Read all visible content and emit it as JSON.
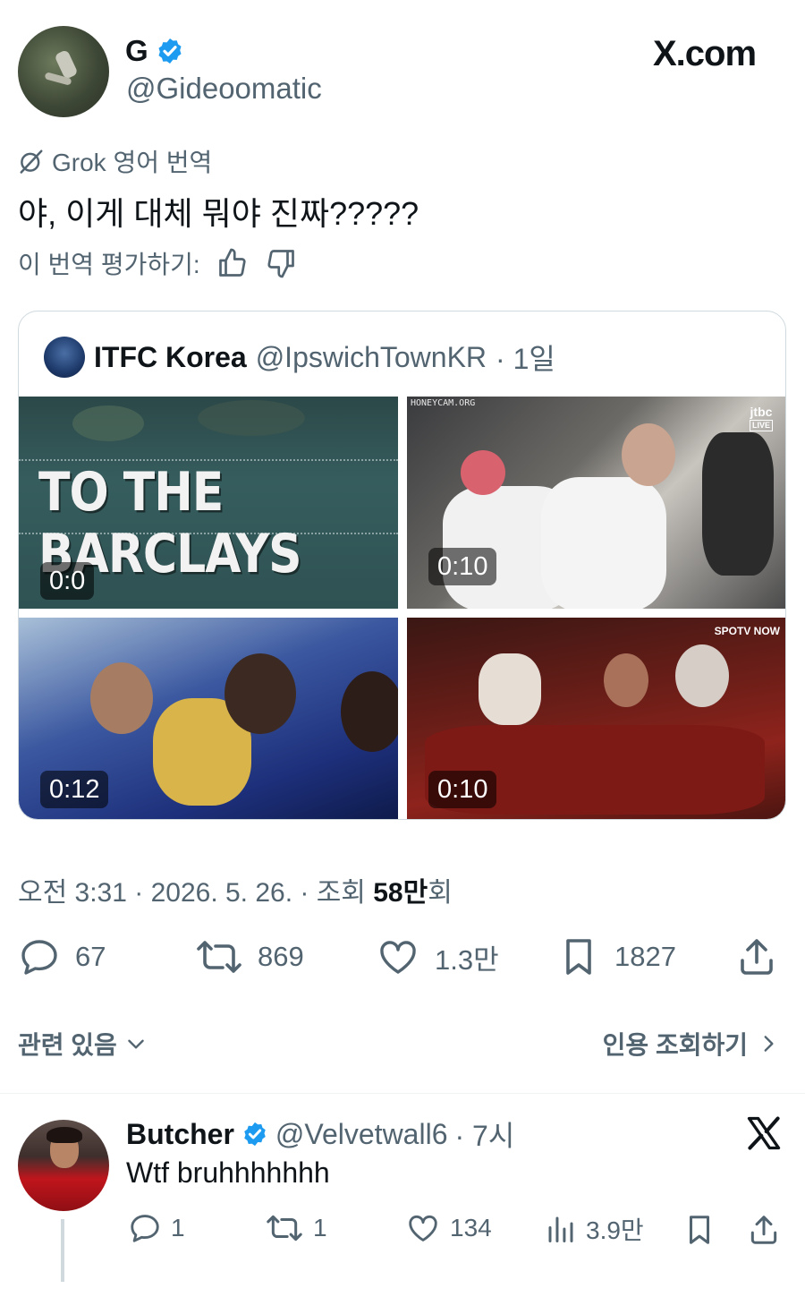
{
  "tweet": {
    "author": {
      "name": "G",
      "handle": "@Gideoomatic",
      "verified": true
    },
    "brand": "X.com",
    "translation_label": "Grok 영어 번역",
    "text": "야, 이게 대체 뭐야 진짜?????",
    "rate_label": "이 번역 평가하기:",
    "quote": {
      "name": "ITFC Korea",
      "handle": "@IpswichTownKR",
      "time": "· 1일",
      "media": [
        {
          "overlay_text": "TO THE BARCLAYS",
          "duration": "0:0"
        },
        {
          "watermark": "HONEYCAM.ORG",
          "channel": "jtbc",
          "channel_badge": "LIVE",
          "duration": "0:10"
        },
        {
          "duration": "0:12"
        },
        {
          "channel": "SPOTV NOW",
          "duration": "0:10"
        }
      ]
    },
    "meta": {
      "time": "오전 3:31 · 2026. 5. 26. · 조회 ",
      "views": "58만",
      "views_suffix": "회"
    },
    "stats": {
      "replies": "67",
      "reposts": "869",
      "likes": "1.3만",
      "bookmarks": "1827"
    },
    "related_label": "관련 있음",
    "quote_views_label": "인용 조회하기"
  },
  "reply": {
    "name": "Butcher",
    "handle": "@Velvetwall6",
    "time": "· 7시",
    "verified": true,
    "text": "Wtf bruhhhhhhh",
    "stats": {
      "replies": "1",
      "reposts": "1",
      "likes": "134",
      "views": "3.9만"
    }
  },
  "colors": {
    "text": "#0f1419",
    "secondary": "#536471",
    "verified": "#1d9bf0",
    "border": "#cfd9de"
  }
}
